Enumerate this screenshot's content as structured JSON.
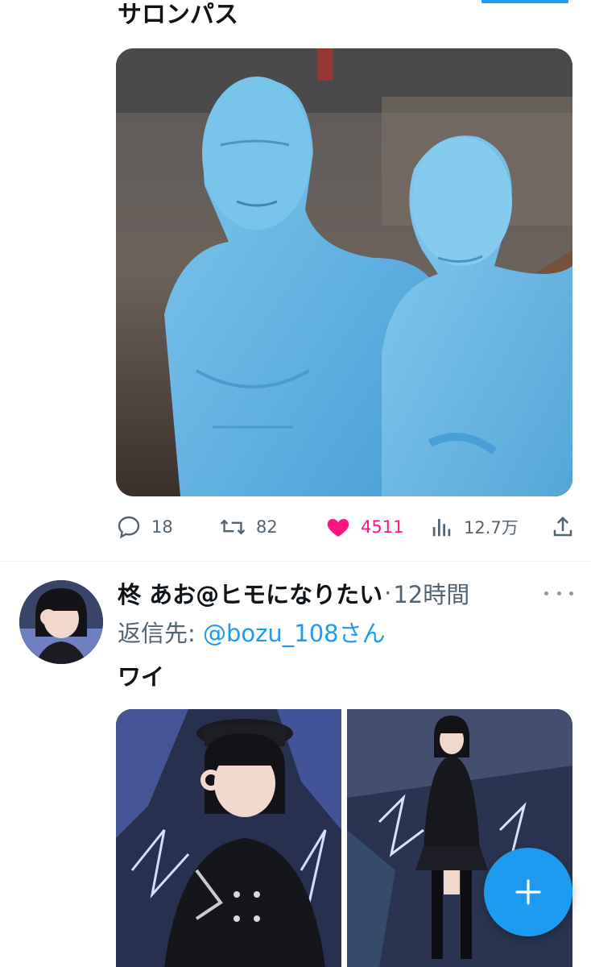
{
  "tweet1": {
    "text": "サロンパス",
    "media_icon": "photo",
    "actions": {
      "reply_count": "18",
      "retweet_count": "82",
      "like_count": "4511",
      "views_count": "12.7万"
    }
  },
  "tweet2": {
    "display_name": "柊 あお@ヒモになりたい",
    "separator": "·",
    "time": "12時間",
    "reply_label": "返信先:",
    "reply_handle": "@bozu_108",
    "reply_suffix": "さん",
    "text": "ワイ"
  },
  "colors": {
    "accent": "#1d9bf0",
    "like": "#f91880",
    "muted": "#536471"
  },
  "icons": {
    "reply": "speech-bubble-icon",
    "retweet": "retweet-icon",
    "like": "heart-filled-icon",
    "views": "bar-chart-icon",
    "share": "share-icon",
    "more": "ellipsis-icon",
    "compose": "plus-icon"
  }
}
